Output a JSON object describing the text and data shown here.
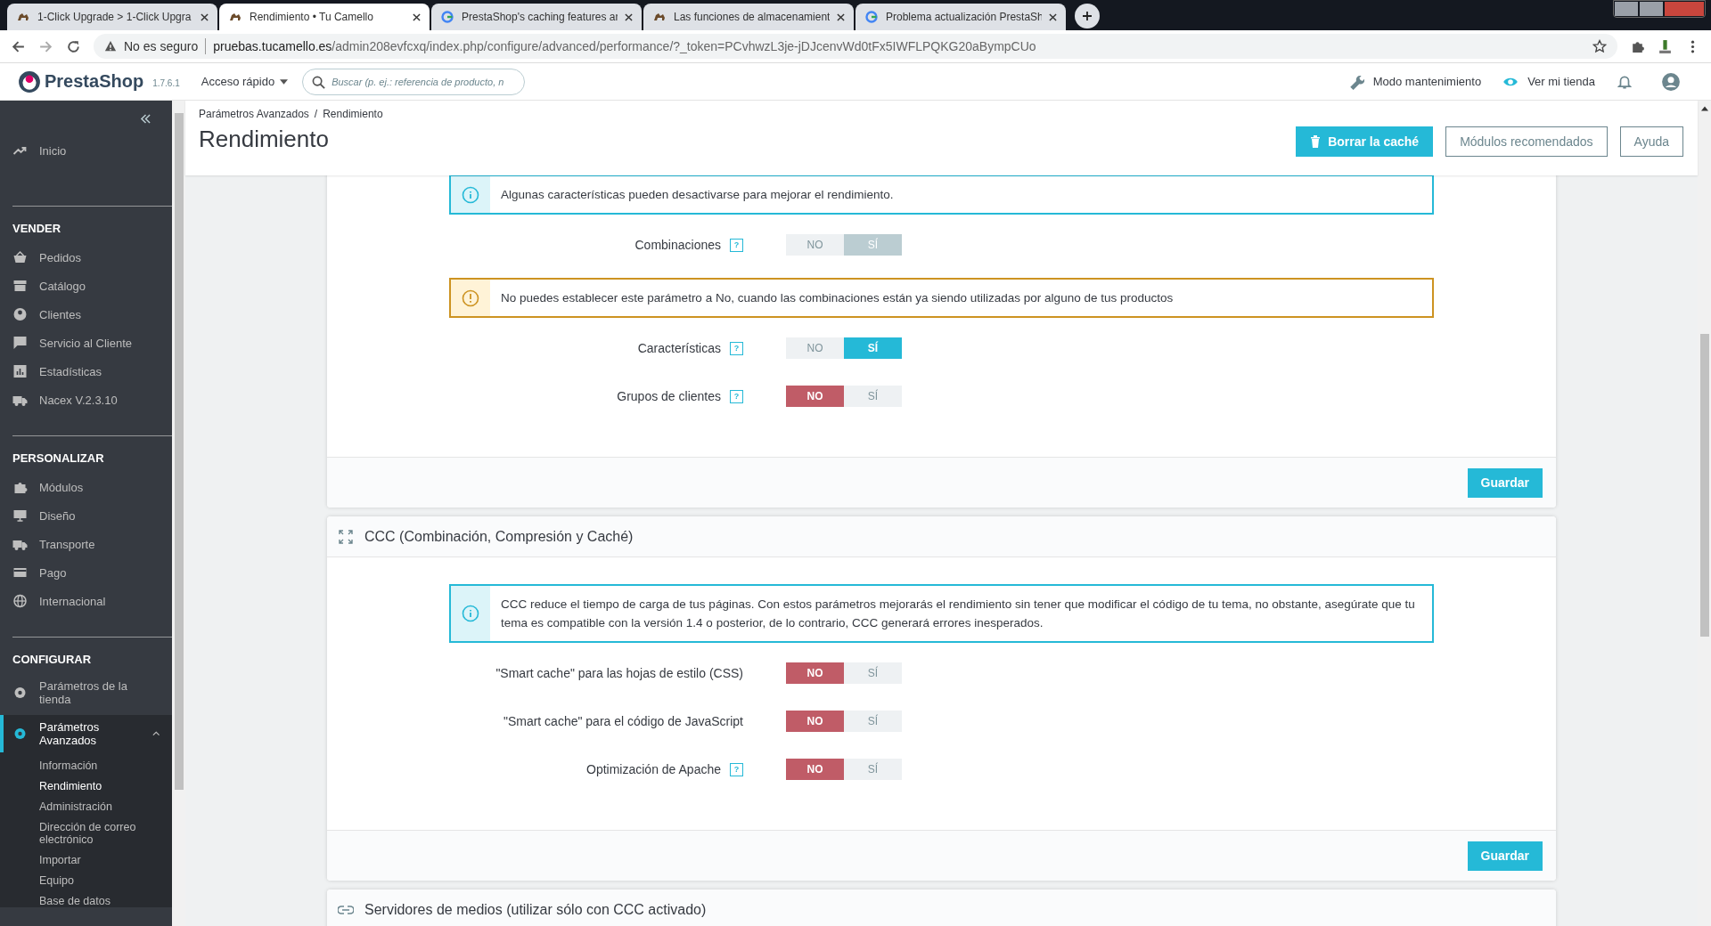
{
  "browser": {
    "tabs": [
      {
        "title": "1-Click Upgrade > 1-Click Upgra",
        "selected": false
      },
      {
        "title": "Rendimiento • Tu Camello",
        "selected": true
      },
      {
        "title": "PrestaShop's caching features ar",
        "selected": false
      },
      {
        "title": "Las funciones de almacenamient",
        "selected": false
      },
      {
        "title": "Problema actualización PrestaSh",
        "selected": false
      }
    ],
    "security": "No es seguro",
    "domain": "pruebas.tucamello.es",
    "path": "/admin208evfcxq/index.php/configure/advanced/performance/?_token=PCvhwzL3je-jDJcenvWd0tFx5IWFLPQKG20aBympCUo"
  },
  "header": {
    "logo": "PrestaShop",
    "version": "1.7.6.1",
    "quick_access": "Acceso rápido",
    "search": {
      "placeholder": "Buscar (p. ej.: referencia de producto, n"
    },
    "maintenance": "Modo mantenimiento",
    "view_store": "Ver mi tienda"
  },
  "sidebar": {
    "home": "Inicio",
    "sections": [
      {
        "title": "VENDER",
        "items": [
          {
            "label": "Pedidos"
          },
          {
            "label": "Catálogo"
          },
          {
            "label": "Clientes"
          },
          {
            "label": "Servicio al Cliente"
          },
          {
            "label": "Estadísticas"
          },
          {
            "label": "Nacex V.2.3.10"
          }
        ]
      },
      {
        "title": "PERSONALIZAR",
        "items": [
          {
            "label": "Módulos"
          },
          {
            "label": "Diseño"
          },
          {
            "label": "Transporte"
          },
          {
            "label": "Pago"
          },
          {
            "label": "Internacional"
          }
        ]
      },
      {
        "title": "CONFIGURAR",
        "items": [
          {
            "label": "Parámetros de la tienda"
          },
          {
            "label": "Parámetros Avanzados",
            "selected": true,
            "expanded": true,
            "children": [
              {
                "label": "Información",
                "selected": false
              },
              {
                "label": "Rendimiento",
                "selected": true
              },
              {
                "label": "Administración",
                "selected": false
              },
              {
                "label": "Dirección de correo electrónico",
                "selected": false
              },
              {
                "label": "Importar",
                "selected": false
              },
              {
                "label": "Equipo",
                "selected": false
              },
              {
                "label": "Base de datos",
                "selected": false
              }
            ]
          }
        ]
      }
    ]
  },
  "page": {
    "breadcrumbs": [
      "Parámetros Avanzados",
      "Rendimiento"
    ],
    "breadcrumb_separator": "/",
    "title": "Rendimiento",
    "toolbar": [
      {
        "label": "Borrar la caché",
        "kind": "primary"
      },
      {
        "label": "Módulos recomendados",
        "kind": "outline"
      },
      {
        "label": "Ayuda",
        "kind": "outline"
      }
    ]
  },
  "panels": [
    {
      "blocks": [
        {
          "kind": "info",
          "text": "Algunas características pueden desactivarse para mejorar el rendimiento."
        },
        {
          "kind": "toggle",
          "label": "Combinaciones",
          "help": "?",
          "disabled": true,
          "options": [
            {
              "label": "NO",
              "selected": false
            },
            {
              "label": "SÍ",
              "selected": true
            }
          ]
        },
        {
          "kind": "warning",
          "text": "No puedes establecer este parámetro a No, cuando las combinaciones están ya siendo utilizadas por alguno de tus productos"
        },
        {
          "kind": "toggle",
          "label": "Características",
          "help": "?",
          "disabled": false,
          "options": [
            {
              "label": "NO",
              "selected": false
            },
            {
              "label": "SÍ",
              "selected": true
            }
          ]
        },
        {
          "kind": "toggle",
          "label": "Grupos de clientes",
          "help": "?",
          "disabled": false,
          "options": [
            {
              "label": "NO",
              "selected": true
            },
            {
              "label": "SÍ",
              "selected": false
            }
          ]
        }
      ],
      "save": "Guardar"
    },
    {
      "title": "CCC (Combinación, Compresión y Caché)",
      "blocks": [
        {
          "kind": "info",
          "text": "CCC reduce el tiempo de carga de tus páginas. Con estos parámetros mejorarás el rendimiento sin tener que modificar el código de tu tema, no obstante, asegúrate que tu tema es compatible con la versión 1.4 o posterior, de lo contrario, CCC generará errores inesperados."
        },
        {
          "kind": "toggle",
          "label": "\"Smart cache\" para las hojas de estilo (CSS)",
          "disabled": false,
          "options": [
            {
              "label": "NO",
              "selected": true
            },
            {
              "label": "SÍ",
              "selected": false
            }
          ]
        },
        {
          "kind": "toggle",
          "label": "\"Smart cache\" para el código de JavaScript",
          "disabled": false,
          "options": [
            {
              "label": "NO",
              "selected": true
            },
            {
              "label": "SÍ",
              "selected": false
            }
          ]
        },
        {
          "kind": "toggle",
          "label": "Optimización de Apache",
          "help": "?",
          "disabled": false,
          "options": [
            {
              "label": "NO",
              "selected": true
            },
            {
              "label": "SÍ",
              "selected": false
            }
          ]
        }
      ],
      "save": "Guardar"
    },
    {
      "title": "Servidores de medios (utilizar sólo con CCC activado)"
    }
  ]
}
